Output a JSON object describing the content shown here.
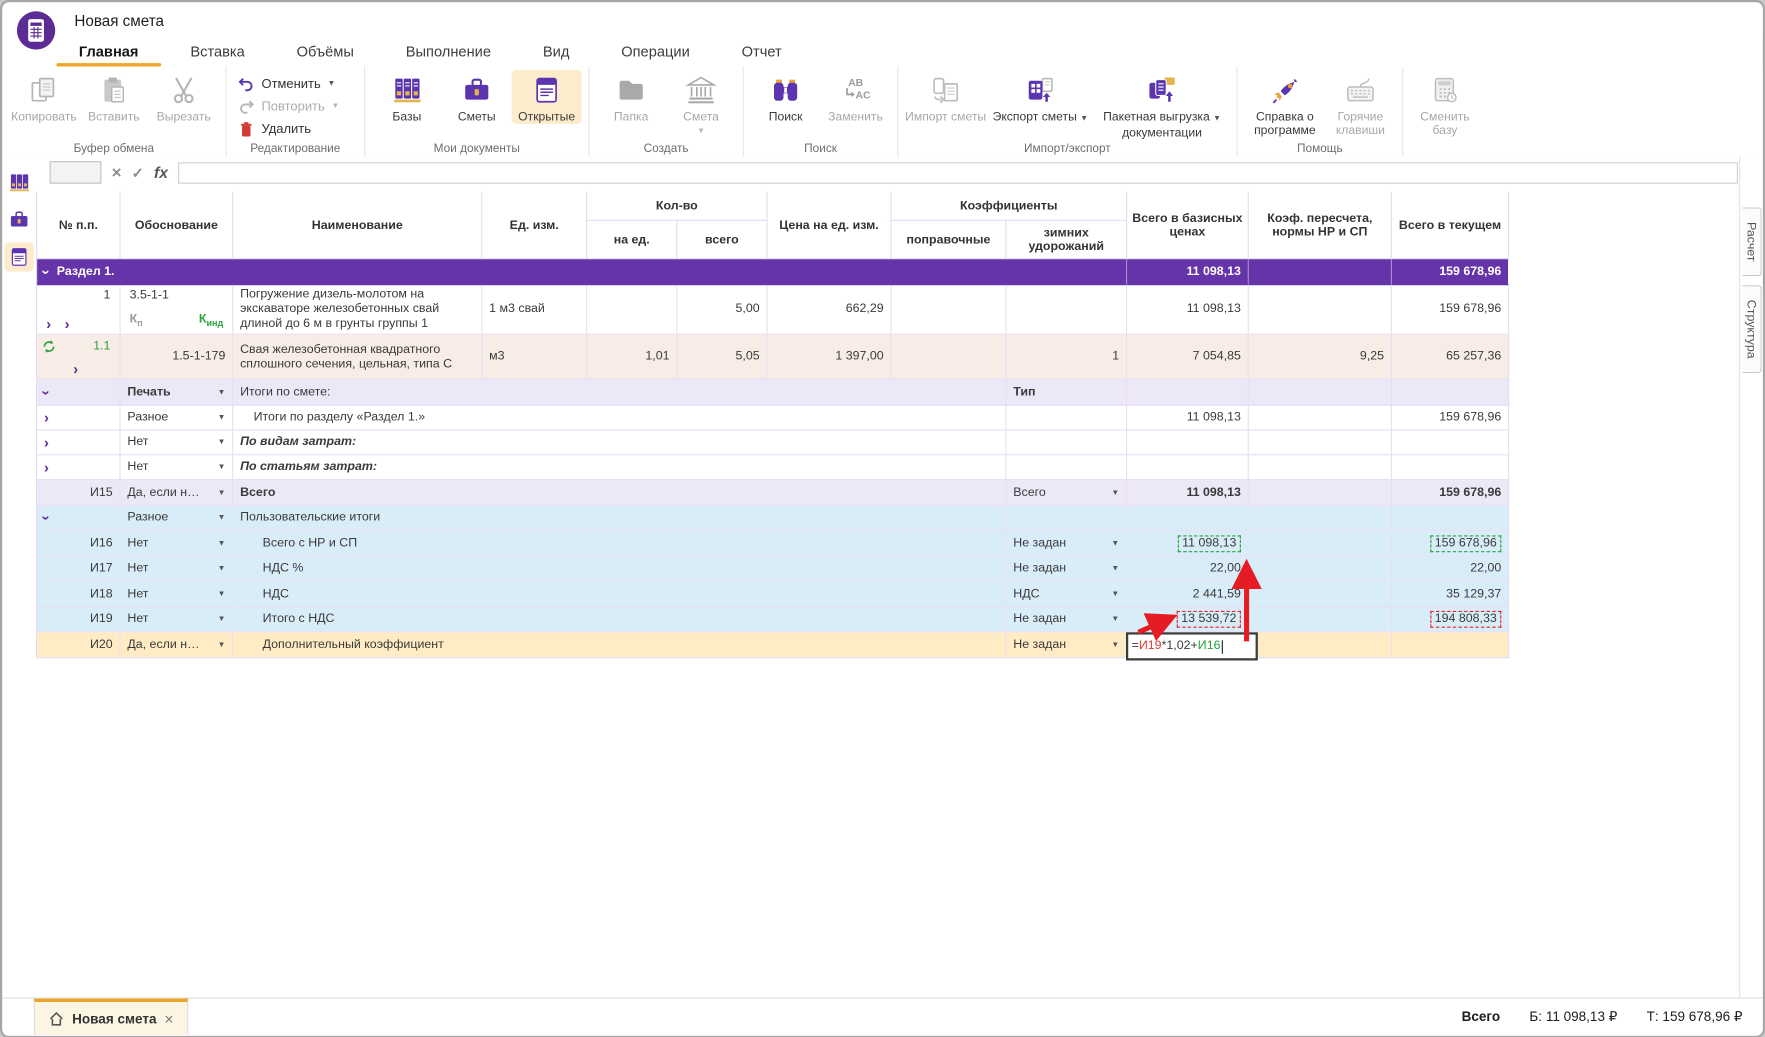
{
  "window": {
    "title": "Новая смета"
  },
  "tabs": [
    {
      "label": "Главная"
    },
    {
      "label": "Вставка"
    },
    {
      "label": "Объёмы"
    },
    {
      "label": "Выполнение"
    },
    {
      "label": "Вид"
    },
    {
      "label": "Операции"
    },
    {
      "label": "Отчет"
    }
  ],
  "ribbon": {
    "clipboard": {
      "label": "Буфер обмена",
      "copy": "Копировать",
      "paste": "Вставить",
      "cut": "Вырезать"
    },
    "editing": {
      "label": "Редактирование",
      "undo": "Отменить",
      "redo": "Повторить",
      "delete": "Удалить"
    },
    "docs": {
      "label": "Мои документы",
      "bases": "Базы",
      "estimates": "Сметы",
      "open": "Открытые"
    },
    "create": {
      "label": "Создать",
      "folder": "Папка",
      "estimate": "Смета"
    },
    "search": {
      "label": "Поиск",
      "find": "Поиск",
      "replace": "Заменить"
    },
    "impexp": {
      "label": "Импорт/экспорт",
      "import": "Импорт сметы",
      "export": "Экспорт сметы",
      "batch_1": "Пакетная выгрузка",
      "batch_2": "документации"
    },
    "help": {
      "label": "Помощь",
      "about_1": "Справка о",
      "about_2": "программе",
      "hotkeys_1": "Горячие",
      "hotkeys_2": "клавиши"
    },
    "change_base_1": "Сменить",
    "change_base_2": "базу"
  },
  "formula_bar": {
    "fx": "fx",
    "cell_value": "",
    "formula_value": ""
  },
  "table": {
    "columns": {
      "num": "№ п.п.",
      "basis": "Обоснование",
      "name": "Наименование",
      "unit": "Ед. изм.",
      "qty": "Кол-во",
      "qty_per": "на ед.",
      "qty_total": "всего",
      "price": "Цена на ед. изм.",
      "coeffs": "Коэффициенты",
      "corrective": "поправочные",
      "winter": "зимних удорожаний",
      "total_base": "Всего в базисных ценах",
      "conv": "Коэф. пересчета, нормы НР и СП",
      "total_cur": "Всего в текущем"
    },
    "rows": {
      "section": {
        "title": "Раздел 1.",
        "total_base": "11 098,13",
        "total_cur": "159 678,96"
      },
      "item1": {
        "num": "1",
        "basis": "3.5-1-1",
        "kp_main": "К",
        "kp_sub": "п",
        "kind_main": "К",
        "kind_sub": "инд",
        "name": "Погружение дизель-молотом на экскаваторе железобетонных свай длиной до 6 м в грунты группы 1",
        "unit": "1 м3 свай",
        "qty_total": "5,00",
        "price": "662,29",
        "total_base": "11 098,13",
        "total_cur": "159 678,96"
      },
      "item11": {
        "num": "1.1",
        "basis": "1.5-1-179",
        "name": "Свая железобетонная квадратного сплошного сечения, цельная, типа С",
        "unit": "м3",
        "qty_per": "1,01",
        "qty_total": "5,05",
        "price": "1 397,00",
        "winter": "1",
        "total_base": "7 054,85",
        "conv": "9,25",
        "total_cur": "65 257,36"
      },
      "totals_header": {
        "dropdown": "Печать",
        "label": "Итоги по смете:",
        "type_label": "Тип"
      },
      "section_totals": {
        "dropdown": "Разное",
        "label": "Итоги по разделу «Раздел 1.»",
        "total_base": "11 098,13",
        "total_cur": "159 678,96"
      },
      "by_types": {
        "dropdown": "Нет",
        "label": "По видам затрат:"
      },
      "by_articles": {
        "dropdown": "Нет",
        "label": "По статьям затрат:"
      },
      "i15": {
        "id": "И15",
        "dropdown": "Да, если н…",
        "label": "Всего",
        "type": "Всего",
        "total_base": "11 098,13",
        "total_cur": "159 678,96"
      },
      "user_totals": {
        "dropdown": "Разное",
        "label": "Пользовательские итоги"
      },
      "i16": {
        "id": "И16",
        "dropdown": "Нет",
        "label": "Всего с НР и СП",
        "type": "Не задан",
        "total_base": "11 098,13",
        "total_cur": "159 678,96"
      },
      "i17": {
        "id": "И17",
        "dropdown": "Нет",
        "label": "НДС %",
        "type": "Не задан",
        "total_base": "22,00",
        "total_cur": "22,00"
      },
      "i18": {
        "id": "И18",
        "dropdown": "Нет",
        "label": "НДС",
        "type": "НДС",
        "total_base": "2 441,59",
        "total_cur": "35 129,37"
      },
      "i19": {
        "id": "И19",
        "dropdown": "Нет",
        "label": "Итого с НДС",
        "type": "Не задан",
        "total_base": "13 539,72",
        "total_cur": "194 808,33"
      },
      "i20": {
        "id": "И20",
        "dropdown": "Да, если н…",
        "label": "Дополнительный коэффициент",
        "type": "Не задан",
        "formula": {
          "eq": "=",
          "ref1": "И19",
          "mid": "*1,02+",
          "ref2": "И16"
        }
      }
    }
  },
  "side_tabs": [
    {
      "label": "Расчет"
    },
    {
      "label": "Структура"
    }
  ],
  "bottom": {
    "doc_tab": "Новая смета",
    "status_label": "Всего",
    "base_total": "Б: 11 098,13 ₽",
    "current_total": "Т: 159 678,96 ₽"
  },
  "glyphs": {
    "caret_down": "▼",
    "chevron_right": "›",
    "close": "×",
    "check": "✓",
    "cancel": "×"
  },
  "colors": {
    "accent_purple": "#5b2c93",
    "accent_orange": "#f0a32a",
    "positive_green": "#27a23c",
    "alert_red": "#e51c23",
    "section_purple": "#6434a8"
  }
}
